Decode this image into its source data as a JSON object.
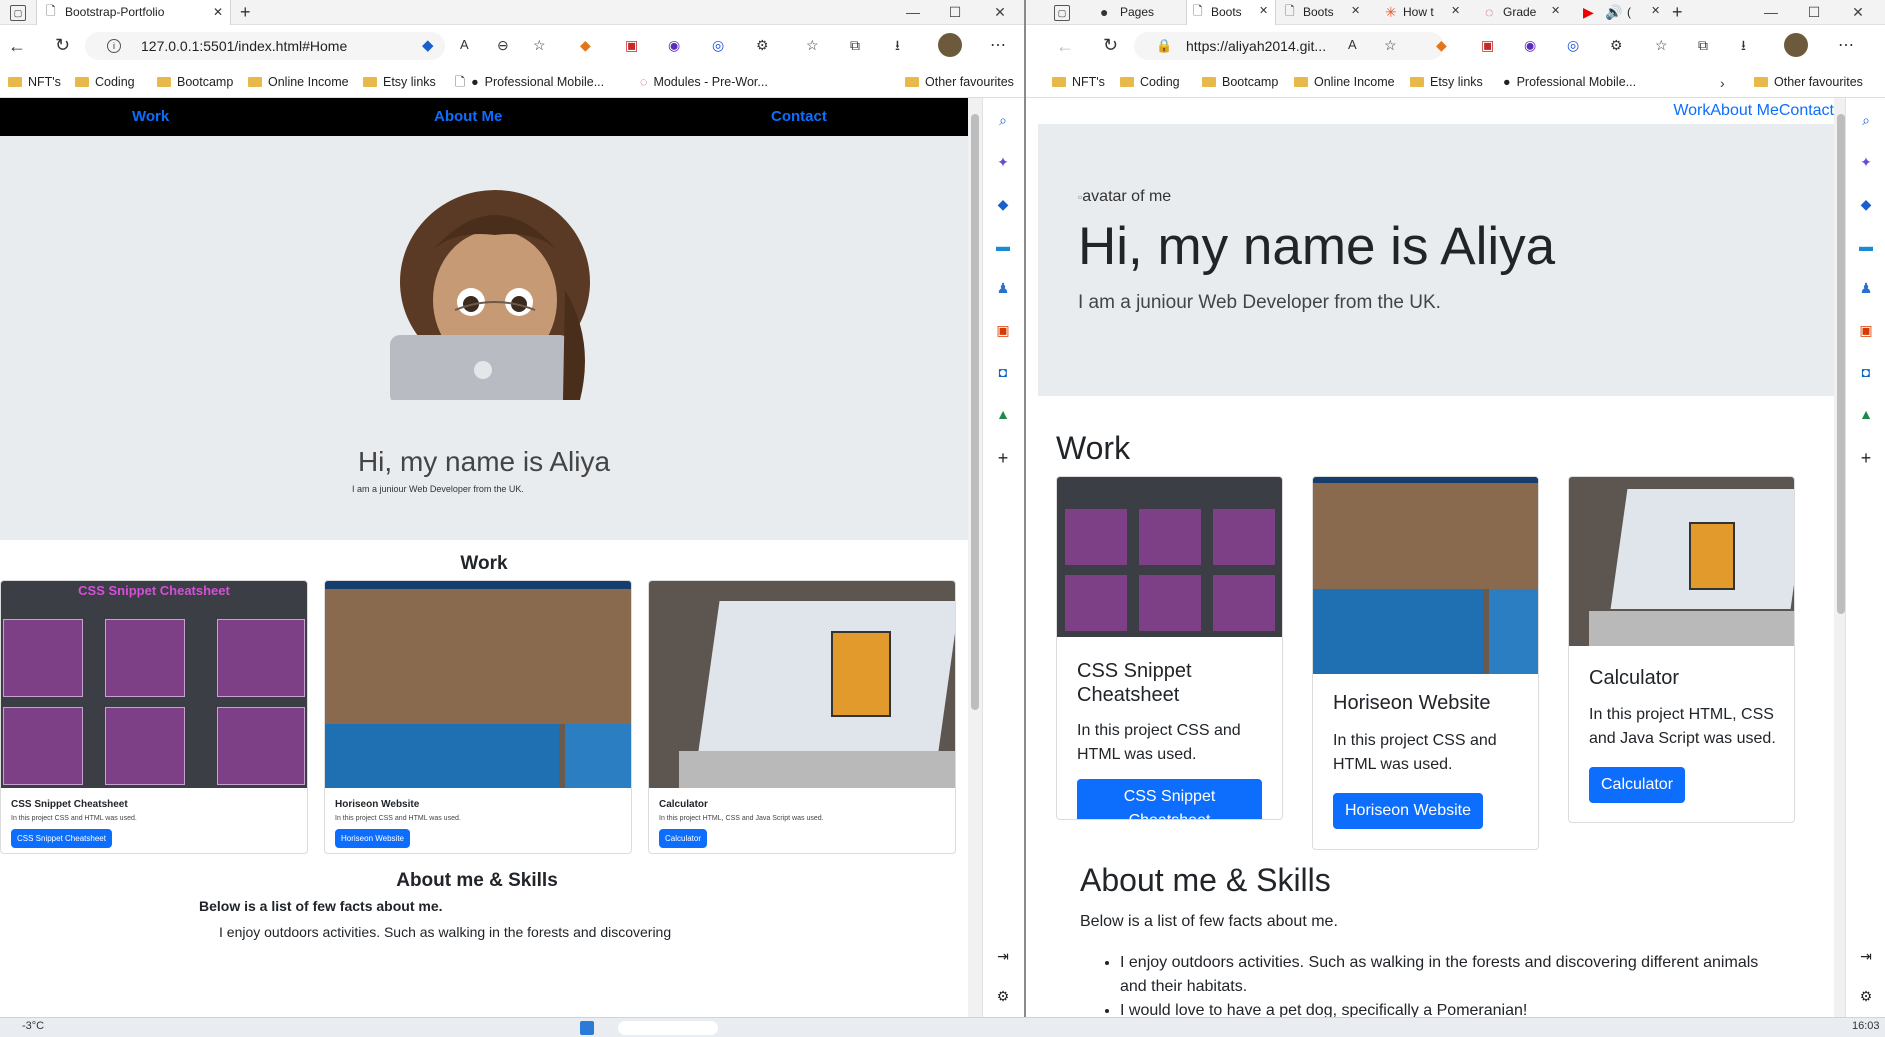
{
  "left_window": {
    "tab_title": "Bootstrap-Portfolio",
    "url": "127.0.0.1:5501/index.html#Home",
    "favourites": [
      "NFT's",
      "Coding",
      "Bootcamp",
      "Online Income",
      "Etsy links",
      "Professional Mobile...",
      "Modules - Pre-Wor...",
      "Other favourites"
    ],
    "nav": [
      "Work",
      "About Me",
      "Contact"
    ],
    "hero_title": "Hi, my name is Aliya",
    "hero_subtitle": "I am a juniour Web Developer from the UK.",
    "work_heading": "Work",
    "cards": [
      {
        "title": "CSS Snippet Cheatsheet",
        "text": "In this project CSS and HTML was used.",
        "button": "CSS Snippet Cheatsheet",
        "thumb_title": "CSS Snippet Cheatsheet"
      },
      {
        "title": "Horiseon Website",
        "text": "In this project CSS and HTML was used.",
        "button": "Horiseon Website"
      },
      {
        "title": "Calculator",
        "text": "In this project HTML, CSS and Java Script was used.",
        "button": "Calculator"
      }
    ],
    "about_heading": "About me & Skills",
    "about_lead": "Below is a list of few facts about me.",
    "about_first": "I enjoy outdoors activities. Such as walking in the forests and discovering"
  },
  "right_window": {
    "tabs": [
      "Pages",
      "Boots",
      "Boots",
      "How t",
      "Grade",
      "("
    ],
    "url": "https://aliyah2014.git...",
    "favourites": [
      "NFT's",
      "Coding",
      "Bootcamp",
      "Online Income",
      "Etsy links",
      "Professional Mobile...",
      "Other favourites"
    ],
    "nav": [
      "Work",
      "About Me",
      "Contact"
    ],
    "avatar_alt": "avatar of me",
    "hero_title": "Hi, my name is Aliya",
    "hero_subtitle": "I am a juniour Web Developer from the UK.",
    "work_heading": "Work",
    "cards": [
      {
        "title": "CSS Snippet Cheatsheet",
        "text": "In this project CSS and HTML was used.",
        "button": "CSS Snippet Cheatsheet"
      },
      {
        "title": "Horiseon Website",
        "text": "In this project CSS and HTML was used.",
        "button": "Horiseon Website"
      },
      {
        "title": "Calculator",
        "text": "In this project HTML, CSS and Java Script was used.",
        "button": "Calculator"
      }
    ],
    "about_heading": "About me & Skills",
    "about_lead": "Below is a list of few facts about me.",
    "facts": [
      "I enjoy outdoors activities. Such as walking in the forests and discovering different animals and their habitats.",
      "I would love to have a pet dog, specifically a Pomeranian!"
    ]
  },
  "taskbar": {
    "weather": "-3°C",
    "time": "16:03"
  },
  "colors": {
    "accent": "#0d6efd",
    "hero_bg": "#e9ecef",
    "nav_bg": "#000000"
  },
  "icons": [
    "search-icon",
    "copilot-icon",
    "shopping-icon",
    "toolbox-icon",
    "games-icon",
    "office-icon",
    "outlook-icon",
    "tree-icon",
    "plus-icon",
    "settings-icon"
  ]
}
